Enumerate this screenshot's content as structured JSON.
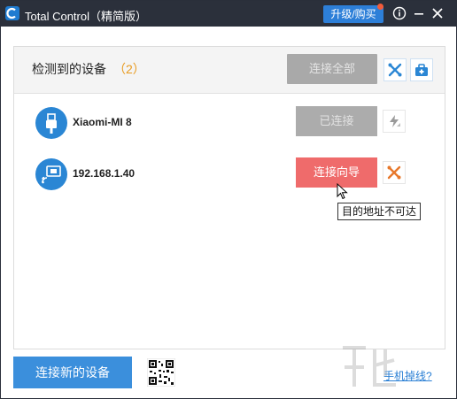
{
  "window": {
    "title": "Total Control（精简版）",
    "upgrade_label": "升级/购买",
    "icons": {
      "info": "info-icon",
      "minimize": "minimize-icon",
      "close": "close-icon"
    }
  },
  "panel": {
    "detected_label": "检测到的设备",
    "detected_count": "（2）",
    "connect_all_label": "连接全部",
    "header_tools": [
      "tools-icon",
      "toolbox-icon"
    ],
    "devices": [
      {
        "name": "Xiaomi-MI 8",
        "icon": "usb-icon",
        "action_label": "已连接",
        "action_state": "disabled",
        "tool_icon": "lightning-icon"
      },
      {
        "name": "192.168.1.40",
        "icon": "wifi-cast-icon",
        "action_label": "连接向导",
        "action_state": "active",
        "tool_icon": "tools-icon"
      }
    ],
    "tooltip": "目的地址不可达"
  },
  "footer": {
    "connect_new_label": "连接新的设备",
    "qr_icon": "qr-code-icon",
    "phone_link": "手机掉线?"
  },
  "colors": {
    "titlebar": "#2b303b",
    "accent_blue": "#3b8fdc",
    "connect_wizard_red": "#ef6b6b",
    "count_orange": "#e89a1e",
    "disabled_gray": "#acacac"
  }
}
